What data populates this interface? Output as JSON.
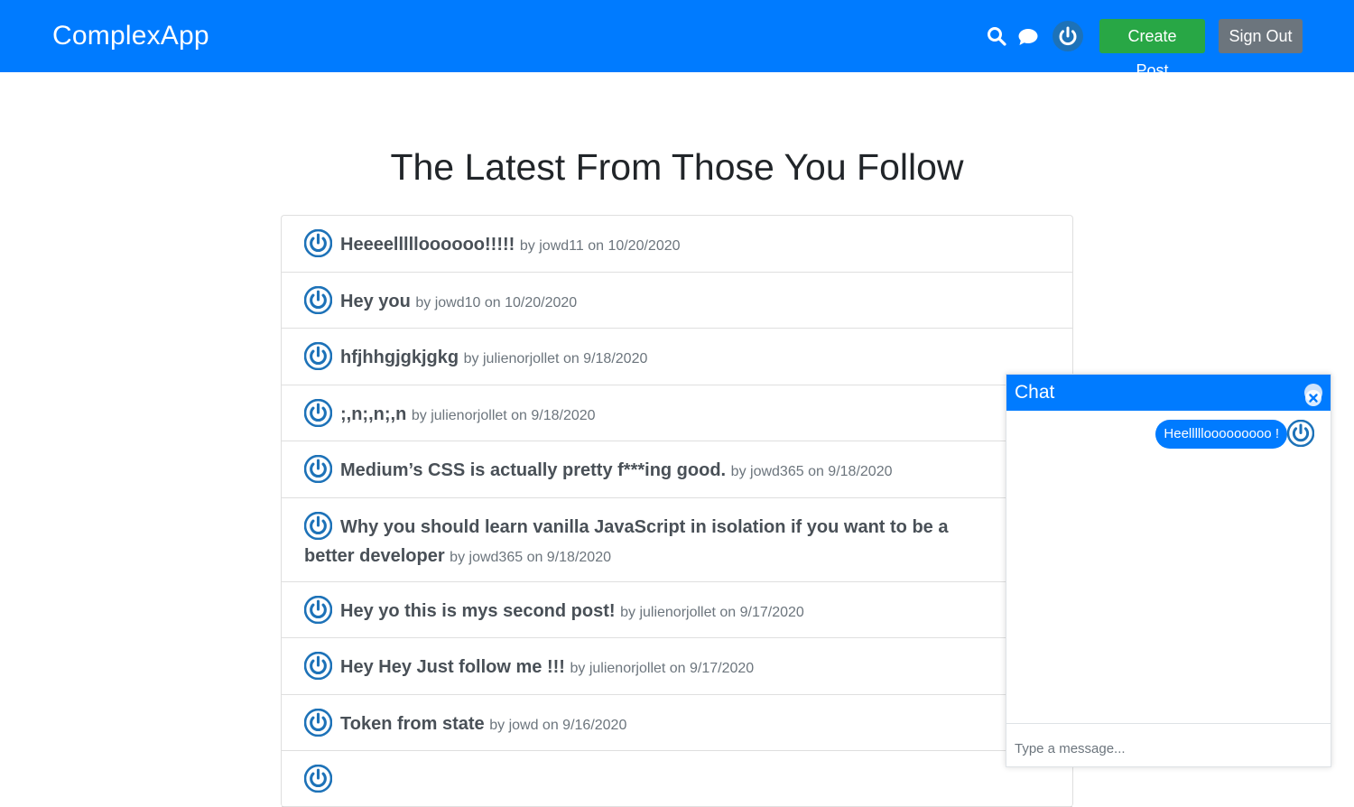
{
  "header": {
    "brand": "ComplexApp",
    "create_post_label": "Create Post",
    "sign_out_label": "Sign Out",
    "icons": [
      "search-icon",
      "chat-icon",
      "avatar"
    ],
    "color": "#007bff"
  },
  "main": {
    "title": "The Latest From Those You Follow",
    "posts": [
      {
        "title": "Heeeellllloooooo!!!!!",
        "meta": "by jowd11 on 10/20/2020"
      },
      {
        "title": "Hey you",
        "meta": "by jowd10 on 10/20/2020"
      },
      {
        "title": "hfjhhgjgkjgkg",
        "meta": "by julienorjollet on 9/18/2020"
      },
      {
        "title": ";,n;,n;,n",
        "meta": "by julienorjollet on 9/18/2020"
      },
      {
        "title": "Medium’s CSS is actually pretty f***ing good.",
        "meta": "by jowd365 on 9/18/2020"
      },
      {
        "title": "Why you should learn vanilla JavaScript in isolation if you want to be a better developer",
        "meta": "by jowd365 on 9/18/2020"
      },
      {
        "title": "Hey yo this is mys second post!",
        "meta": "by julienorjollet on 9/17/2020"
      },
      {
        "title": "Hey Hey Just follow me !!!",
        "meta": "by julienorjollet on 9/17/2020"
      },
      {
        "title": "Token from state",
        "meta": "by jowd on 9/16/2020"
      },
      {
        "title": "",
        "meta": ""
      }
    ]
  },
  "chat": {
    "title": "Chat",
    "messages": [
      {
        "text": "Heelllllooooooooo !"
      }
    ],
    "input_placeholder": "Type a message..."
  }
}
